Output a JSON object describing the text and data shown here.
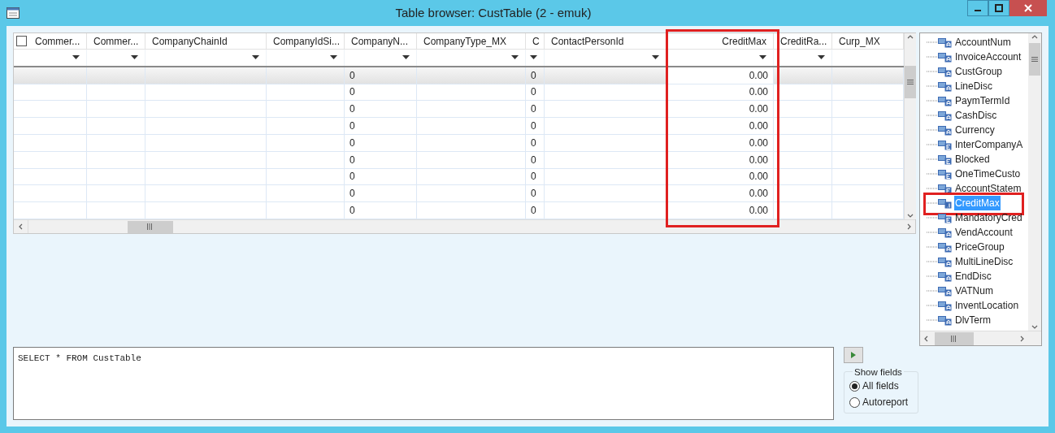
{
  "window": {
    "title": "Table browser: CustTable (2 - emuk)"
  },
  "grid": {
    "all_selected": false,
    "columns": [
      {
        "label": "Commer...",
        "kind": "text",
        "filter": true,
        "highlighted": false
      },
      {
        "label": "Commer...",
        "kind": "text",
        "filter": true,
        "highlighted": false
      },
      {
        "label": "CompanyChainId",
        "kind": "text",
        "filter": true,
        "highlighted": false
      },
      {
        "label": "CompanyIdSi...",
        "kind": "text",
        "filter": true,
        "highlighted": false
      },
      {
        "label": "CompanyN...",
        "kind": "int",
        "filter": true,
        "highlighted": false
      },
      {
        "label": "CompanyType_MX",
        "kind": "text",
        "filter": true,
        "highlighted": false
      },
      {
        "label": "C",
        "kind": "int",
        "filter": true,
        "highlighted": false
      },
      {
        "label": "ContactPersonId",
        "kind": "text",
        "filter": true,
        "highlighted": false
      },
      {
        "label": "CreditMax",
        "kind": "real",
        "filter": true,
        "highlighted": true
      },
      {
        "label": "CreditRa...",
        "kind": "text",
        "filter": true,
        "highlighted": false
      },
      {
        "label": "Curp_MX",
        "kind": "text",
        "filter": false,
        "highlighted": false
      }
    ],
    "rows": [
      {
        "selected": true,
        "company_n": "0",
        "c": "0",
        "credit_max": "0.00"
      },
      {
        "selected": false,
        "company_n": "0",
        "c": "0",
        "credit_max": "0.00"
      },
      {
        "selected": false,
        "company_n": "0",
        "c": "0",
        "credit_max": "0.00"
      },
      {
        "selected": false,
        "company_n": "0",
        "c": "0",
        "credit_max": "0.00"
      },
      {
        "selected": false,
        "company_n": "0",
        "c": "0",
        "credit_max": "0.00"
      },
      {
        "selected": false,
        "company_n": "0",
        "c": "0",
        "credit_max": "0.00"
      },
      {
        "selected": false,
        "company_n": "0",
        "c": "0",
        "credit_max": "0.00"
      },
      {
        "selected": false,
        "company_n": "0",
        "c": "0",
        "credit_max": "0.00"
      },
      {
        "selected": false,
        "company_n": "0",
        "c": "0",
        "credit_max": "0.00"
      }
    ]
  },
  "field_tree": {
    "items": [
      {
        "label": "AccountNum",
        "kind": "string",
        "selected": false,
        "highlighted": false
      },
      {
        "label": "InvoiceAccount",
        "kind": "string",
        "selected": false,
        "highlighted": false
      },
      {
        "label": "CustGroup",
        "kind": "string",
        "selected": false,
        "highlighted": false
      },
      {
        "label": "LineDisc",
        "kind": "string",
        "selected": false,
        "highlighted": false
      },
      {
        "label": "PaymTermId",
        "kind": "string",
        "selected": false,
        "highlighted": false
      },
      {
        "label": "CashDisc",
        "kind": "string",
        "selected": false,
        "highlighted": false
      },
      {
        "label": "Currency",
        "kind": "string",
        "selected": false,
        "highlighted": false
      },
      {
        "label": "InterCompanyA",
        "kind": "enum",
        "selected": false,
        "highlighted": false
      },
      {
        "label": "Blocked",
        "kind": "enum",
        "selected": false,
        "highlighted": false
      },
      {
        "label": "OneTimeCusto",
        "kind": "enum",
        "selected": false,
        "highlighted": false
      },
      {
        "label": "AccountStatem",
        "kind": "enum",
        "selected": false,
        "highlighted": false
      },
      {
        "label": "CreditMax",
        "kind": "real",
        "selected": true,
        "highlighted": true
      },
      {
        "label": "MandatoryCred",
        "kind": "enum",
        "selected": false,
        "highlighted": false
      },
      {
        "label": "VendAccount",
        "kind": "string",
        "selected": false,
        "highlighted": false
      },
      {
        "label": "PriceGroup",
        "kind": "string",
        "selected": false,
        "highlighted": false
      },
      {
        "label": "MultiLineDisc",
        "kind": "string",
        "selected": false,
        "highlighted": false
      },
      {
        "label": "EndDisc",
        "kind": "string",
        "selected": false,
        "highlighted": false
      },
      {
        "label": "VATNum",
        "kind": "string",
        "selected": false,
        "highlighted": false
      },
      {
        "label": "InventLocation",
        "kind": "string",
        "selected": false,
        "highlighted": false
      },
      {
        "label": "DlvTerm",
        "kind": "string",
        "selected": false,
        "highlighted": false
      }
    ]
  },
  "query": {
    "value": "SELECT * FROM CustTable"
  },
  "show_fields": {
    "title": "Show fields",
    "options": [
      {
        "label": "All fields",
        "selected": true
      },
      {
        "label": "Autoreport",
        "selected": false
      }
    ]
  }
}
